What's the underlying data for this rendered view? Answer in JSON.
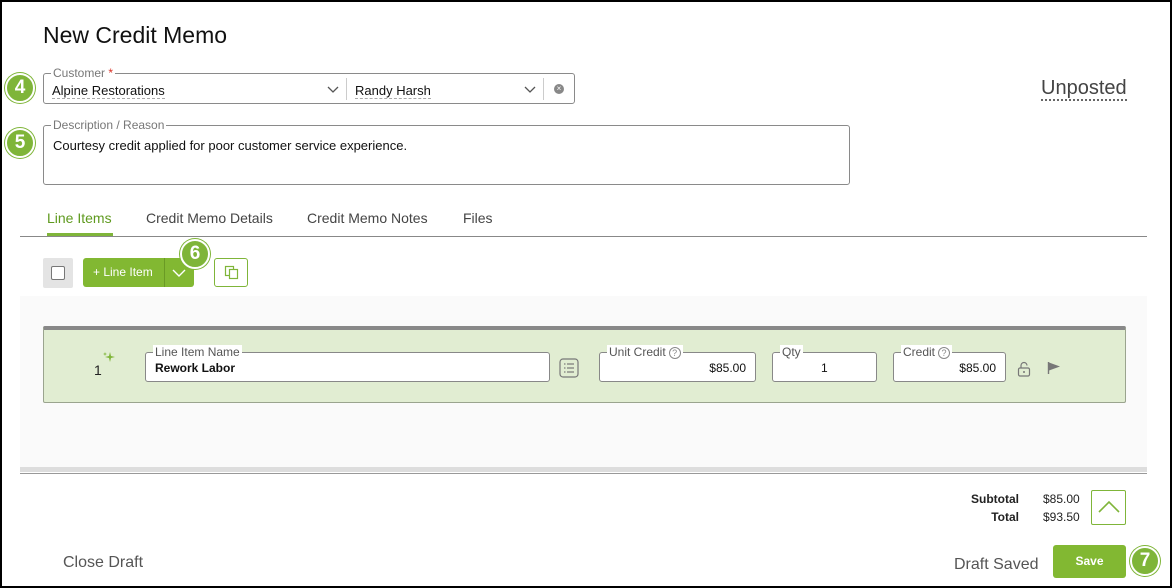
{
  "page": {
    "title": "New Credit Memo",
    "status": "Unposted"
  },
  "callouts": [
    "4",
    "5",
    "6",
    "7"
  ],
  "customer": {
    "label": "Customer",
    "required_mark": "*",
    "company": "Alpine Restorations",
    "contact": "Randy Harsh"
  },
  "description": {
    "label": "Description / Reason",
    "value": "Courtesy credit applied for poor customer service experience."
  },
  "tabs": [
    {
      "label": "Line Items",
      "active": true
    },
    {
      "label": "Credit Memo Details",
      "active": false
    },
    {
      "label": "Credit Memo Notes",
      "active": false
    },
    {
      "label": "Files",
      "active": false
    }
  ],
  "toolbar": {
    "add_line_item_label": "+ Line Item"
  },
  "line_items": [
    {
      "number": "1",
      "name_label": "Line Item Name",
      "name": "Rework Labor",
      "unit_credit_label": "Unit Credit",
      "unit_credit": "$85.00",
      "qty_label": "Qty",
      "qty": "1",
      "credit_label": "Credit",
      "credit": "$85.00"
    }
  ],
  "totals": {
    "subtotal_label": "Subtotal",
    "subtotal": "$85.00",
    "total_label": "Total",
    "total": "$93.50"
  },
  "footer": {
    "close_draft_label": "Close Draft",
    "draft_saved_label": "Draft Saved",
    "save_label": "Save"
  },
  "colors": {
    "accent": "#82b832",
    "row_bg": "#e1edd2"
  },
  "icons": [
    "chevron-down-icon",
    "clear-icon",
    "copy-icon",
    "sparkle-icon",
    "list-icon",
    "help-icon",
    "unlock-icon",
    "flag-icon",
    "chevron-up-icon"
  ]
}
